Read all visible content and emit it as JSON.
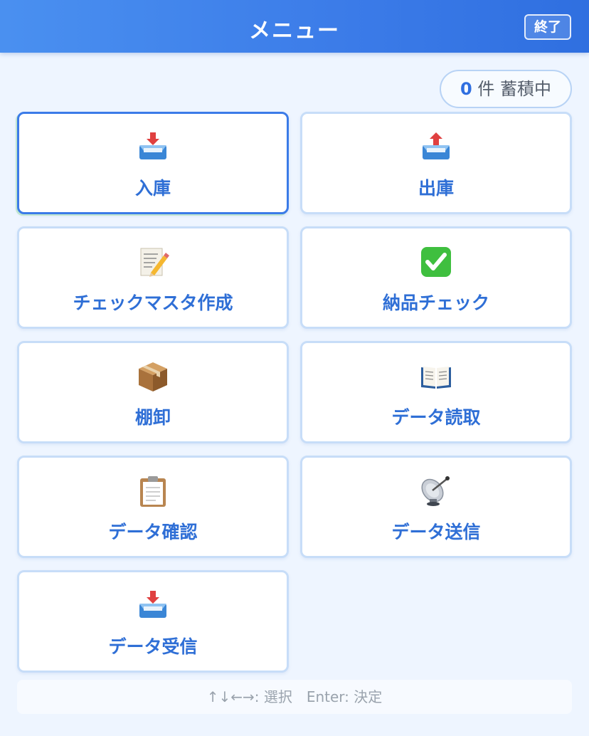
{
  "header": {
    "title": "メニュー",
    "exit_label": "終了"
  },
  "status": {
    "count": "0",
    "count_text": "件 蓄積中"
  },
  "menu": [
    {
      "label": "入庫",
      "icon": "inbox-tray-icon"
    },
    {
      "label": "出庫",
      "icon": "outbox-tray-icon"
    },
    {
      "label": "チェックマスタ作成",
      "icon": "memo-pencil-icon"
    },
    {
      "label": "納品チェック",
      "icon": "check-mark-icon"
    },
    {
      "label": "棚卸",
      "icon": "package-box-icon"
    },
    {
      "label": "データ読取",
      "icon": "open-book-icon"
    },
    {
      "label": "データ確認",
      "icon": "clipboard-icon"
    },
    {
      "label": "データ送信",
      "icon": "satellite-dish-icon"
    },
    {
      "label": "データ受信",
      "icon": "inbox-tray-icon"
    }
  ],
  "footer": {
    "hint": "↑↓←→: 選択　Enter: 決定"
  },
  "colors": {
    "header": "#3b7be8",
    "accent": "#2f6fd6",
    "background": "#eef5ff"
  }
}
